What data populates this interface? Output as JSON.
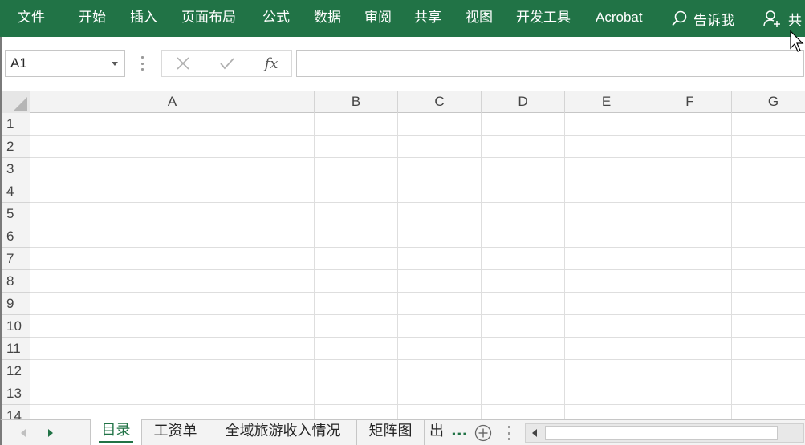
{
  "ribbon": {
    "tabs": [
      "文件",
      "开始",
      "插入",
      "页面布局",
      "公式",
      "数据",
      "审阅",
      "共享",
      "视图",
      "开发工具",
      "Acrobat"
    ],
    "tell_me": "告诉我",
    "share": "共",
    "accent_color": "#217346"
  },
  "formula_bar": {
    "name_box": "A1",
    "cancel_icon": "x-icon",
    "enter_icon": "check-icon",
    "function_label": "fx",
    "formula_value": ""
  },
  "grid": {
    "columns": [
      "A",
      "B",
      "C",
      "D",
      "E",
      "F",
      "G"
    ],
    "rows": [
      "1",
      "2",
      "3",
      "4",
      "5",
      "6",
      "7",
      "8",
      "9",
      "10",
      "11",
      "12",
      "13",
      "14"
    ]
  },
  "sheets": {
    "tabs": [
      "目录",
      "工资单",
      "全域旅游收入情况",
      "矩阵图",
      "出"
    ],
    "active": "目录",
    "more": "..."
  }
}
